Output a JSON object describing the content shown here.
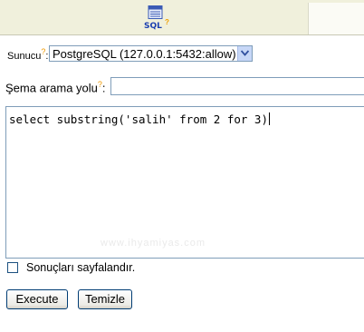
{
  "toolbar": {
    "sql_tab_label": "SQL",
    "sql_tab_help": "?"
  },
  "server": {
    "label": "Sunucu",
    "help": "?",
    "selected": "PostgreSQL (127.0.0.1:5432:allow)"
  },
  "schema": {
    "label": "Şema arama yolu",
    "help": "?",
    "value": ""
  },
  "query": {
    "text": "select substring('salih' from 2 for 3)",
    "watermark": "www.ihyamiyas.com"
  },
  "paginate": {
    "label": "Sonuçları sayfalandır.",
    "checked": false
  },
  "buttons": {
    "execute": "Execute",
    "clear": "Temizle"
  },
  "colors": {
    "topbar": "#f0f0dc",
    "accent_help": "#f09a00",
    "sql_label": "#1a3fb0",
    "field_border": "#7f9db9"
  }
}
